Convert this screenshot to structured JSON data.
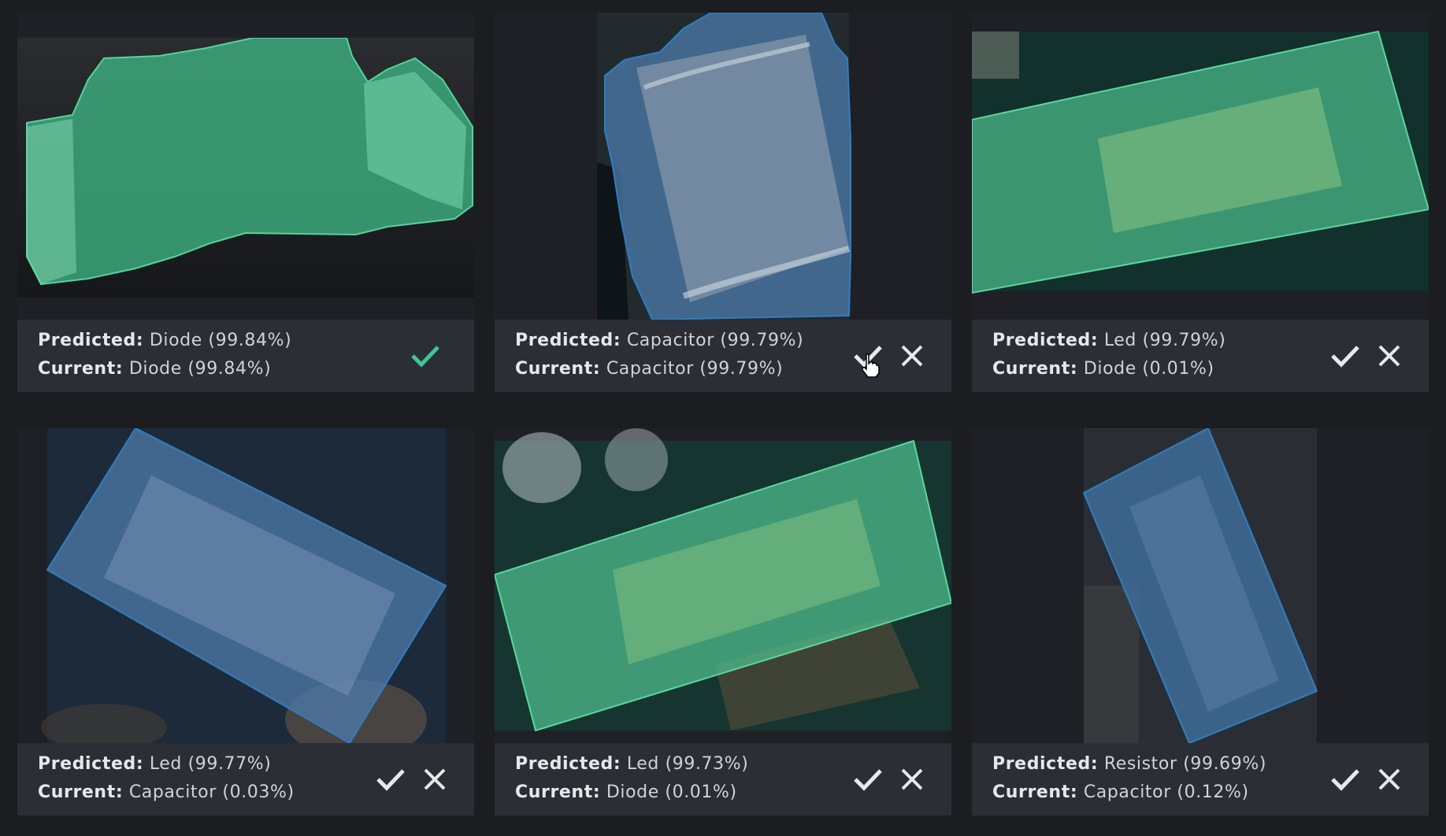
{
  "colors": {
    "background": "#1c1d21",
    "info_bar": "#2b2e35",
    "accent_green": "#3fc890",
    "accent_blue": "#2f7ec0",
    "icon": "#e8e9eb"
  },
  "labels": {
    "predicted": "Predicted",
    "current": "Current",
    "separator": ":"
  },
  "cards": [
    {
      "predicted": "Diode (99.84%)",
      "current": "Diode (99.84%)",
      "overlay_color": "green",
      "status": "accepted",
      "actions": [
        "check-icon"
      ]
    },
    {
      "predicted": "Capacitor (99.79%)",
      "current": "Capacitor (99.79%)",
      "overlay_color": "blue",
      "status": "pending",
      "actions": [
        "check-icon",
        "close-icon"
      ],
      "cursor": "hand-pointer-icon"
    },
    {
      "predicted": "Led (99.79%)",
      "current": "Diode (0.01%)",
      "overlay_color": "green",
      "status": "pending",
      "actions": [
        "check-icon",
        "close-icon"
      ]
    },
    {
      "predicted": "Led (99.77%)",
      "current": "Capacitor (0.03%)",
      "overlay_color": "blue",
      "status": "pending",
      "actions": [
        "check-icon",
        "close-icon"
      ]
    },
    {
      "predicted": "Led (99.73%)",
      "current": "Diode (0.01%)",
      "overlay_color": "green",
      "status": "pending",
      "actions": [
        "check-icon",
        "close-icon"
      ]
    },
    {
      "predicted": "Resistor (99.69%)",
      "current": "Capacitor (0.12%)",
      "overlay_color": "blue",
      "status": "pending",
      "actions": [
        "check-icon",
        "close-icon"
      ]
    }
  ]
}
